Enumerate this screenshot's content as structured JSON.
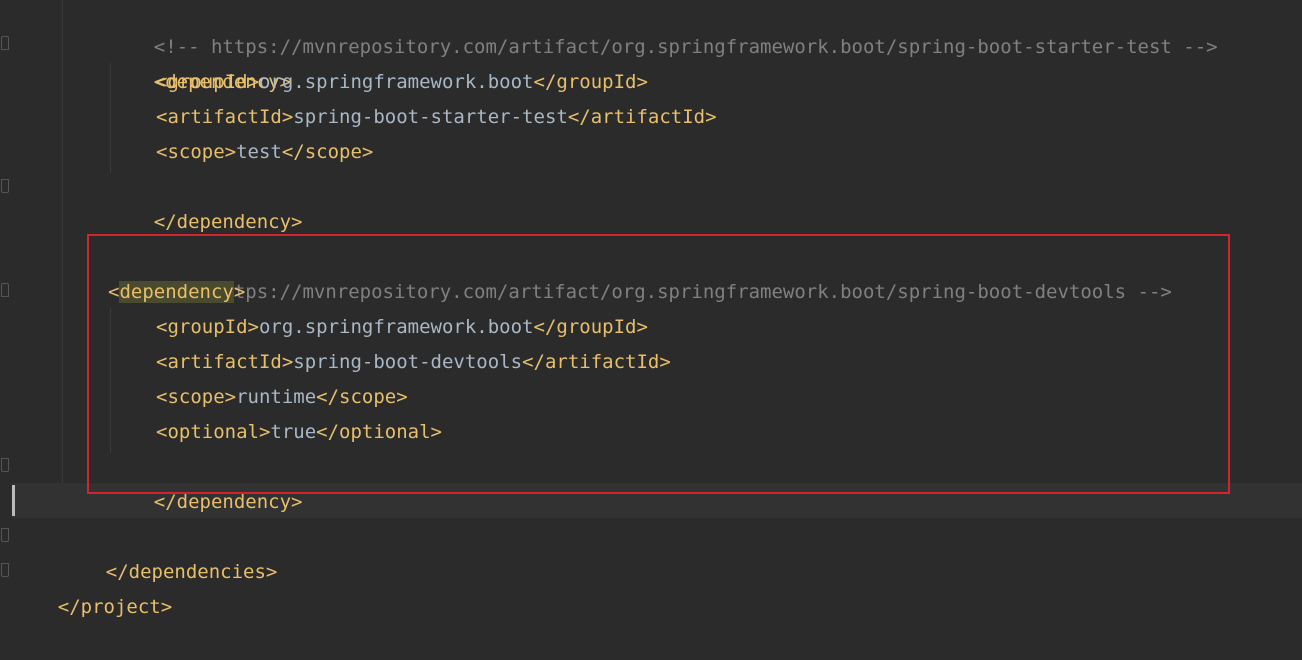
{
  "editor": {
    "file_type": "xml",
    "colors": {
      "background": "#2b2b2b",
      "tag": "#e8bf6a",
      "text": "#a9b7c6",
      "comment": "#808080",
      "highlight_box": "#d0252c",
      "brace_match": "#4a4a2e"
    },
    "lines": [
      {
        "comment": "<!-- https://mvnrepository.com/artifact/org.springframework.boot/spring-boot-starter-test -->"
      },
      {
        "open": "<dependency>"
      },
      {
        "open": "<groupId>",
        "text": "org.springframework.boot",
        "close": "</groupId>"
      },
      {
        "open": "<artifactId>",
        "text": "spring-boot-starter-test",
        "close": "</artifactId>"
      },
      {
        "open": "<scope>",
        "text": "test",
        "close": "</scope>"
      },
      {
        "close": "</dependency>"
      },
      {
        "comment": "<!-- https://mvnrepository.com/artifact/org.springframework.boot/spring-boot-devtools -->"
      },
      {
        "bracket_l": "<",
        "match": "dependency",
        "bracket_r": ">"
      },
      {
        "open": "<groupId>",
        "text": "org.springframework.boot",
        "close": "</groupId>"
      },
      {
        "open": "<artifactId>",
        "text": "spring-boot-devtools",
        "close": "</artifactId>"
      },
      {
        "open": "<scope>",
        "text": "runtime",
        "close": "</scope>"
      },
      {
        "open": "<optional>",
        "text": "true",
        "close": "</optional>"
      },
      {
        "close": "</dependency>"
      },
      {
        "close": "</dependencies>"
      },
      {
        "close": "</project>"
      }
    ]
  }
}
